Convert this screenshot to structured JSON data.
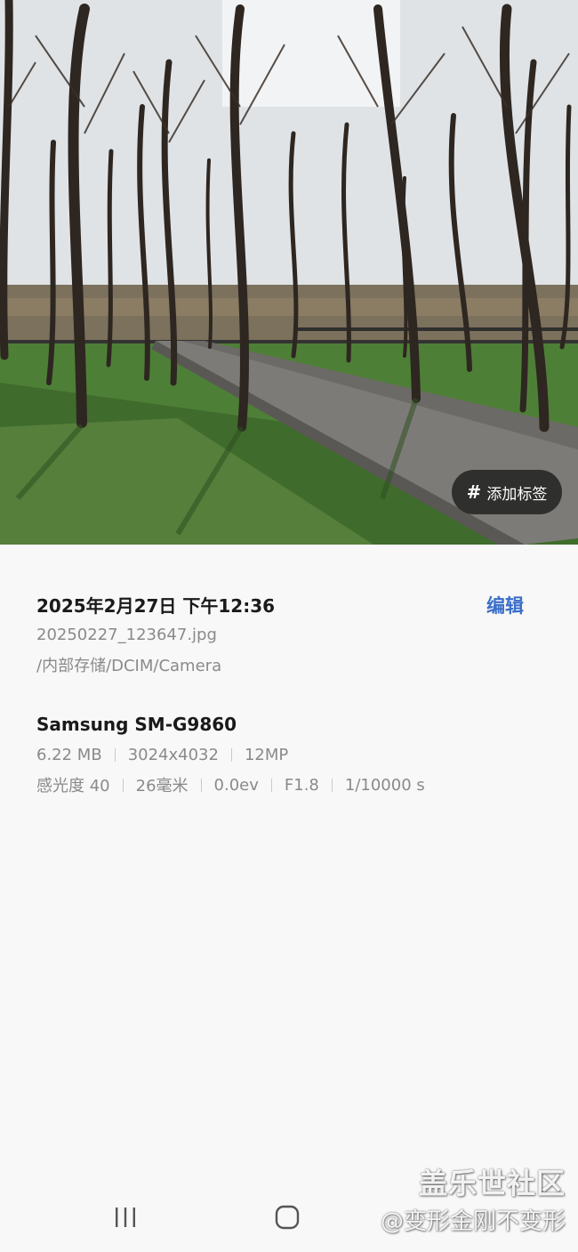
{
  "photo": {
    "add_tag_label": "添加标签",
    "hash_symbol": "#"
  },
  "details": {
    "datetime": "2025年2月27日 下午12:36",
    "edit_label": "编辑",
    "filename": "20250227_123647.jpg",
    "filepath": "/内部存储/DCIM/Camera",
    "device": "Samsung SM-G9860",
    "file_size": "6.22 MB",
    "resolution": "3024x4032",
    "megapixels": "12MP",
    "iso": "感光度 40",
    "focal_length": "26毫米",
    "exposure": "0.0ev",
    "aperture": "F1.8",
    "shutter": "1/10000 s"
  },
  "navigation": {
    "recents_icon": "recents-icon",
    "home_icon": "home-icon"
  },
  "watermark": {
    "line1": "盖乐世社区",
    "line2": "@变形金刚不变形"
  },
  "colors": {
    "accent": "#3a6ec8",
    "background": "#f8f8f8",
    "primary_text": "#1a1a1a",
    "secondary_text": "#8a8a8a"
  }
}
